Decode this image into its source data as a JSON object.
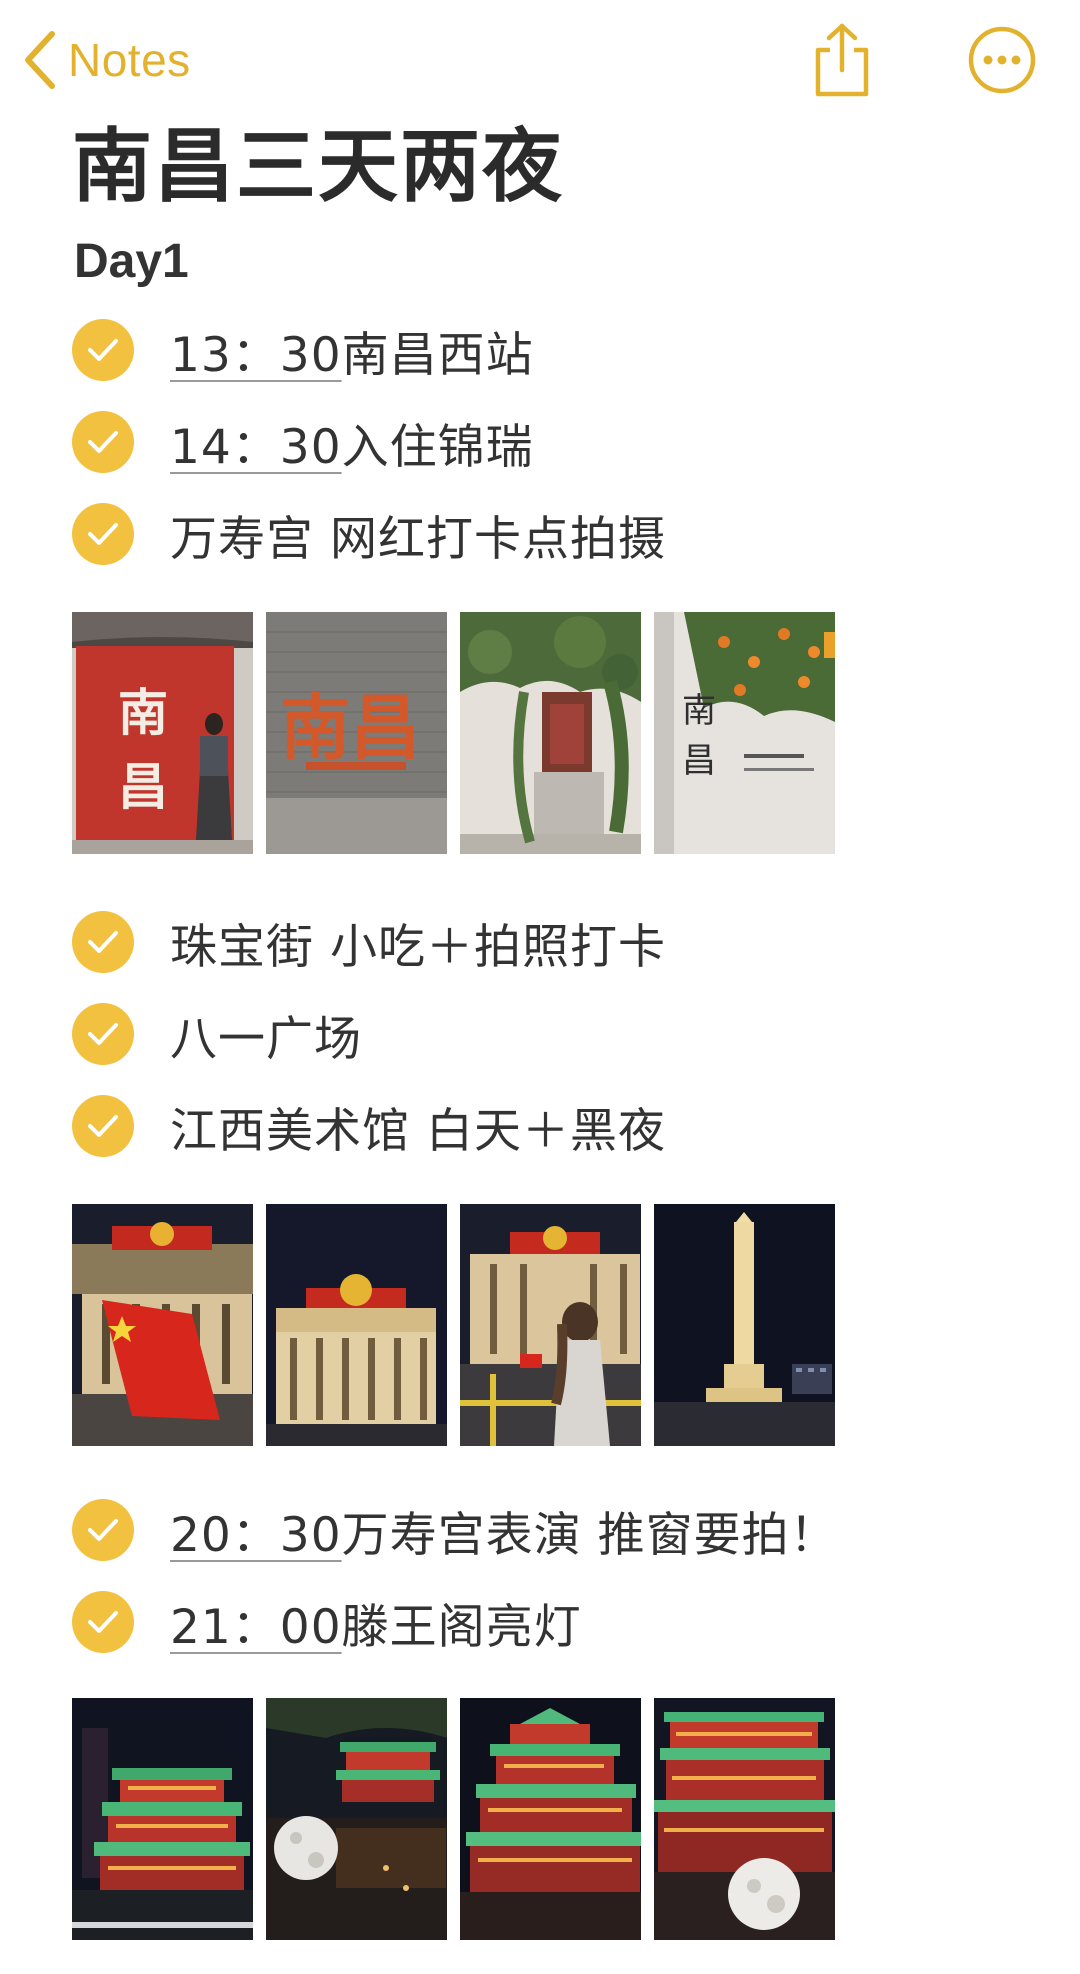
{
  "nav": {
    "back_label": "Notes",
    "back_icon": "chevron-left-icon",
    "share_icon": "share-icon",
    "more_icon": "ellipsis-circle-icon",
    "accent_color": "#e2b22f"
  },
  "note": {
    "title": "南昌三天两夜",
    "day_heading": "Day1",
    "check_color": "#f2c140",
    "items": [
      {
        "time": "13：30",
        "text": "南昌西站",
        "done": true
      },
      {
        "time": "14：30",
        "text": "入住锦瑞",
        "done": true
      },
      {
        "time": "",
        "text": "万寿宫 网红打卡点拍摄",
        "done": true
      },
      {
        "time": "",
        "text": "珠宝街 小吃＋拍照打卡",
        "done": true
      },
      {
        "time": "",
        "text": "八一广场",
        "done": true
      },
      {
        "time": "",
        "text": "江西美术馆 白天＋黑夜",
        "done": true
      },
      {
        "time": "20：30",
        "text": "万寿宫表演 推窗要拍！",
        "done": true
      },
      {
        "time": "21：00",
        "text": "滕王阁亮灯",
        "done": true
      }
    ],
    "photo_rows": [
      {
        "after_item": 3,
        "photos": [
          {
            "subject": "red wall with 南昌 characters, girl posing",
            "wall_text": "南昌"
          },
          {
            "subject": "grey brick wall with orange flower 南昌 lettering",
            "wall_text": "南昌"
          },
          {
            "subject": "white wall with ivy-covered doorway",
            "wall_text": ""
          },
          {
            "subject": "white wall with orange flowers and 南昌 calligraphy",
            "wall_text": "南昌"
          }
        ]
      },
      {
        "after_item": 6,
        "photos": [
          {
            "subject": "Bayi square building at night with red flag",
            "wall_text": ""
          },
          {
            "subject": "Bayi memorial hall at night",
            "wall_text": ""
          },
          {
            "subject": "girl at night in front of hall holding flag",
            "wall_text": ""
          },
          {
            "subject": "illuminated monument tower at night",
            "wall_text": ""
          }
        ]
      },
      {
        "after_item": 8,
        "photos": [
          {
            "subject": "Tengwang pavilion lit up green and red",
            "wall_text": ""
          },
          {
            "subject": "pavilion with glowing moon on water",
            "wall_text": ""
          },
          {
            "subject": "pavilion close-up lit up",
            "wall_text": ""
          },
          {
            "subject": "pavilion with moon lantern",
            "wall_text": ""
          }
        ]
      }
    ]
  }
}
